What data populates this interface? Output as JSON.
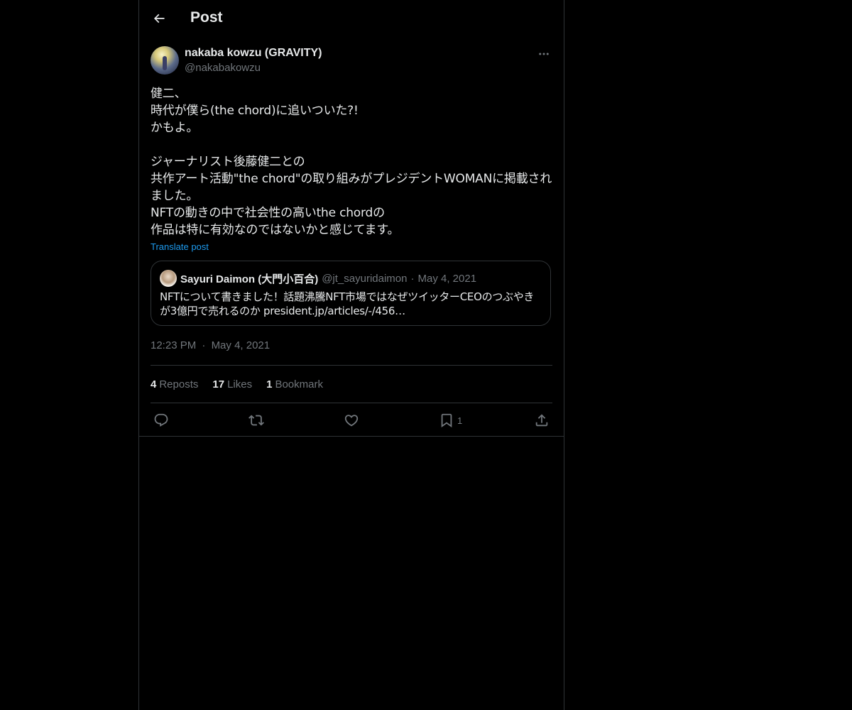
{
  "header": {
    "title": "Post"
  },
  "post": {
    "author_name": "nakaba kowzu (GRAVITY)",
    "author_handle": "@nakabakowzu",
    "body": "健二、\n時代が僕ら(the chord)に追いついた?!\nかもよ。\n\nジャーナリスト後藤健二との\n共作アート活動\"the chord\"の取り組みがプレジデントWOMANに掲載されました。\nNFTの動きの中で社会性の高いthe chordの\n作品は特に有効なのではないかと感じてます。",
    "translate_label": "Translate post",
    "quote": {
      "name": "Sayuri Daimon (大門小百合)",
      "handle": "@jt_sayuridaimon",
      "separator": "·",
      "date": "May 4, 2021",
      "text": "NFTについて書きました！話題沸騰NFT市場ではなぜツイッターCEOのつぶやきが3億円で売れるのか president.jp/articles/-/456…"
    },
    "time": "12:23 PM",
    "meta_separator": "·",
    "date": "May 4, 2021",
    "stats": {
      "reposts_count": "4",
      "reposts_label": "Reposts",
      "likes_count": "17",
      "likes_label": "Likes",
      "bookmarks_count": "1",
      "bookmarks_label": "Bookmark"
    },
    "actions": {
      "bookmark_count": "1"
    }
  },
  "icons": {
    "back": "arrow-left-icon",
    "more": "more-horizontal-icon",
    "reply": "reply-icon",
    "repost": "repost-icon",
    "like": "heart-icon",
    "bookmark": "bookmark-icon",
    "share": "share-icon"
  },
  "colors": {
    "background": "#000000",
    "text_primary": "#e7e9ea",
    "text_secondary": "#71767b",
    "link": "#1d9bf0",
    "border": "#2f3336"
  }
}
